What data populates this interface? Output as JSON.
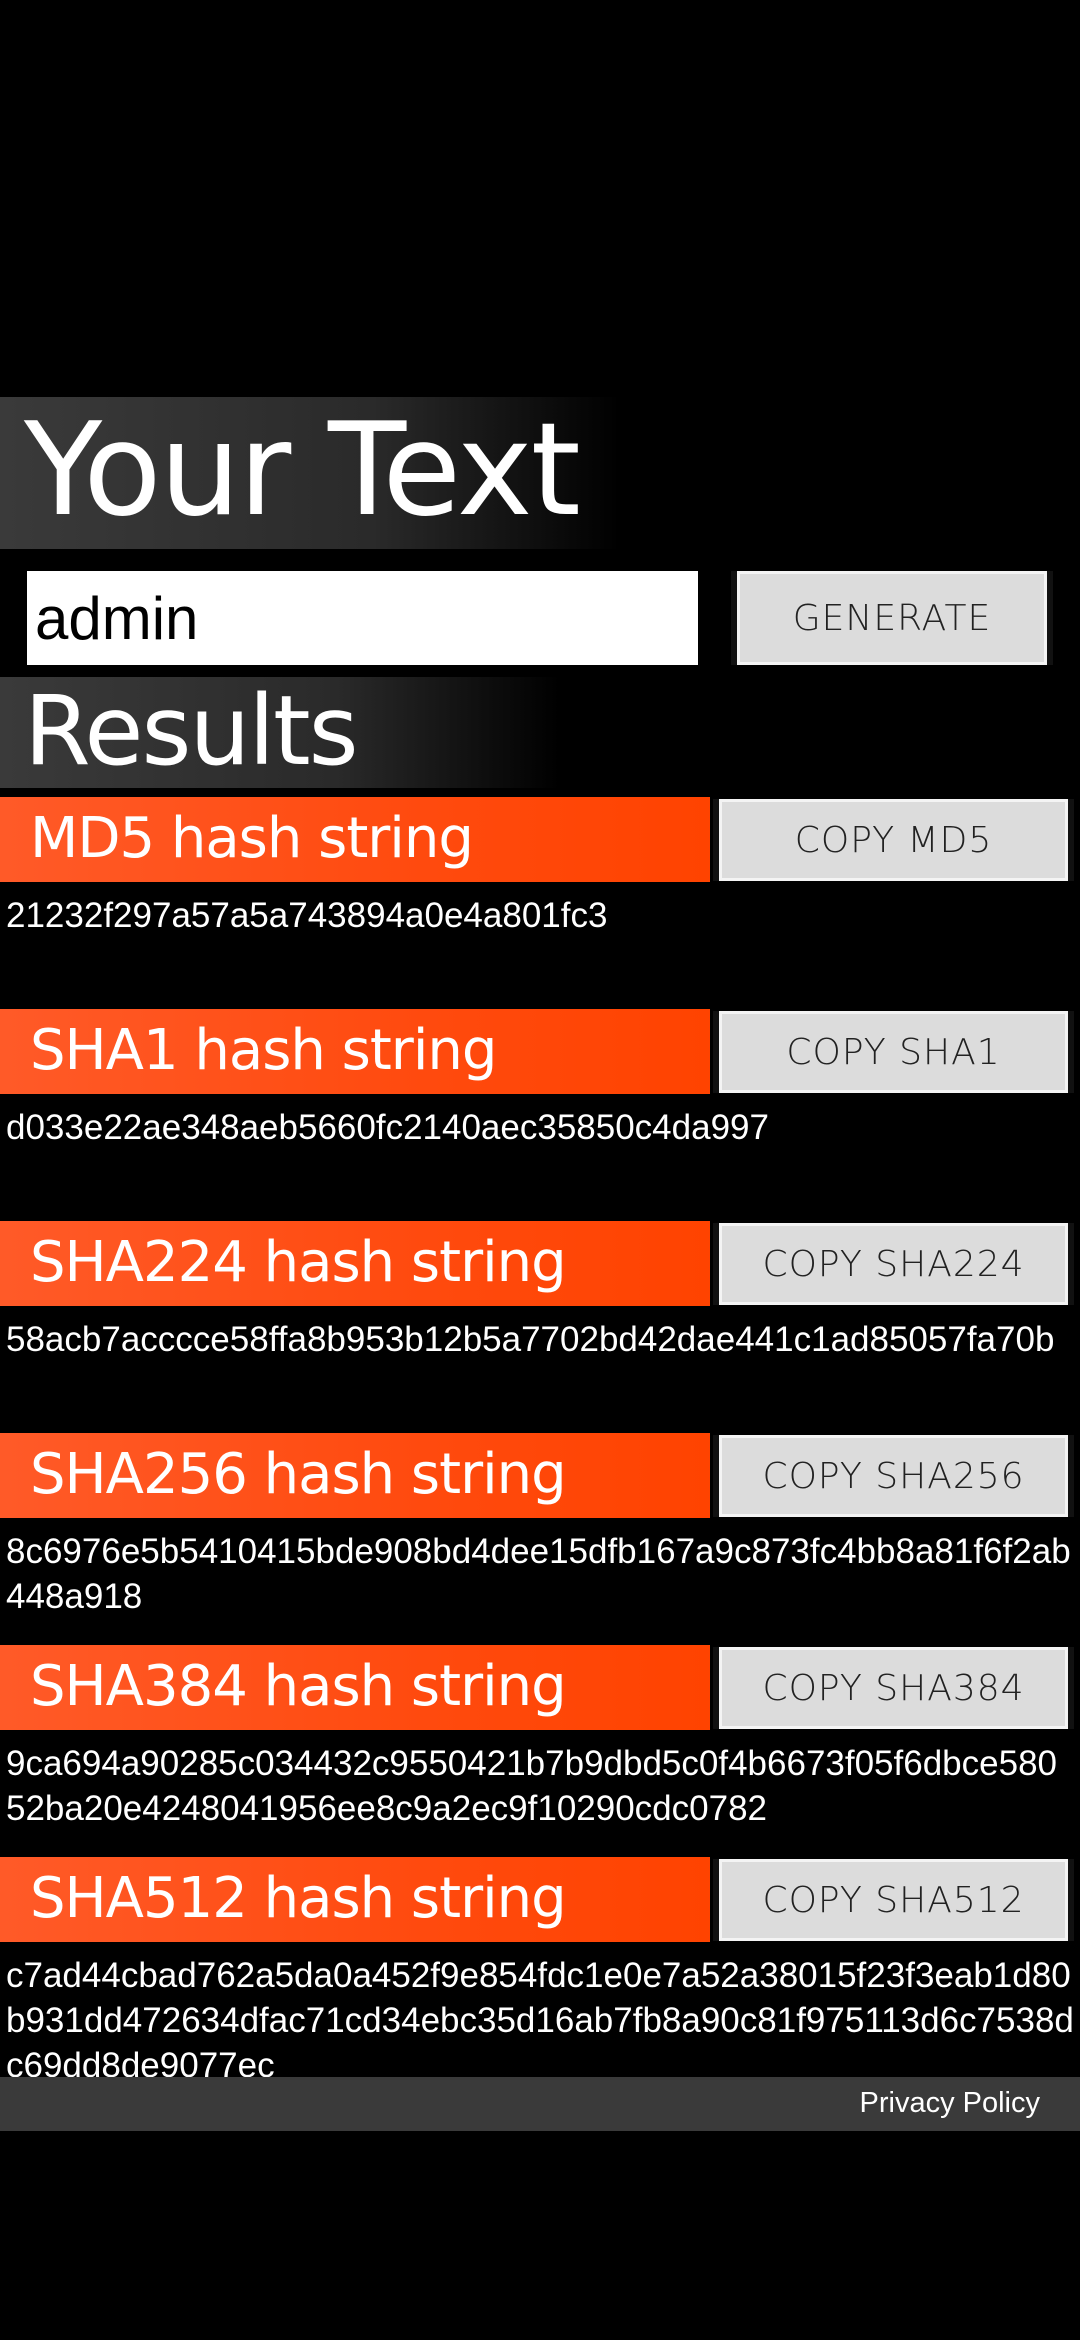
{
  "header": {
    "title": "Your Text"
  },
  "input": {
    "value": "admin"
  },
  "generate_label": "GENERATE",
  "results": {
    "title": "Results"
  },
  "sections": [
    {
      "title": "MD5 hash string",
      "button": "COPY MD5",
      "hash": "21232f297a57a5a743894a0e4a801fc3"
    },
    {
      "title": "SHA1 hash string",
      "button": "COPY SHA1",
      "hash": "d033e22ae348aeb5660fc2140aec35850c4da997"
    },
    {
      "title": "SHA224 hash string",
      "button": "COPY SHA224",
      "hash": "58acb7acccce58ffa8b953b12b5a7702bd42dae441c1ad85057fa70b"
    },
    {
      "title": "SHA256 hash string",
      "button": "COPY SHA256",
      "hash": "8c6976e5b5410415bde908bd4dee15dfb167a9c873fc4bb8a81f6f2ab448a918"
    },
    {
      "title": "SHA384 hash string",
      "button": "COPY SHA384",
      "hash": "9ca694a90285c034432c9550421b7b9dbd5c0f4b6673f05f6dbce58052ba20e4248041956ee8c9a2ec9f10290cdc0782"
    },
    {
      "title": "SHA512 hash string",
      "button": "COPY SHA512",
      "hash": "c7ad44cbad762a5da0a452f9e854fdc1e0e7a52a38015f23f3eab1d80b931dd472634dfac71cd34ebc35d16ab7fb8a90c81f975113d6c7538dc69dd8de9077ec"
    }
  ],
  "footer": {
    "privacy": "Privacy Policy"
  },
  "colors": {
    "accent": "#ff4a0e",
    "button_bg": "#dcdcdc",
    "footer_bg": "#3a3a3a"
  }
}
